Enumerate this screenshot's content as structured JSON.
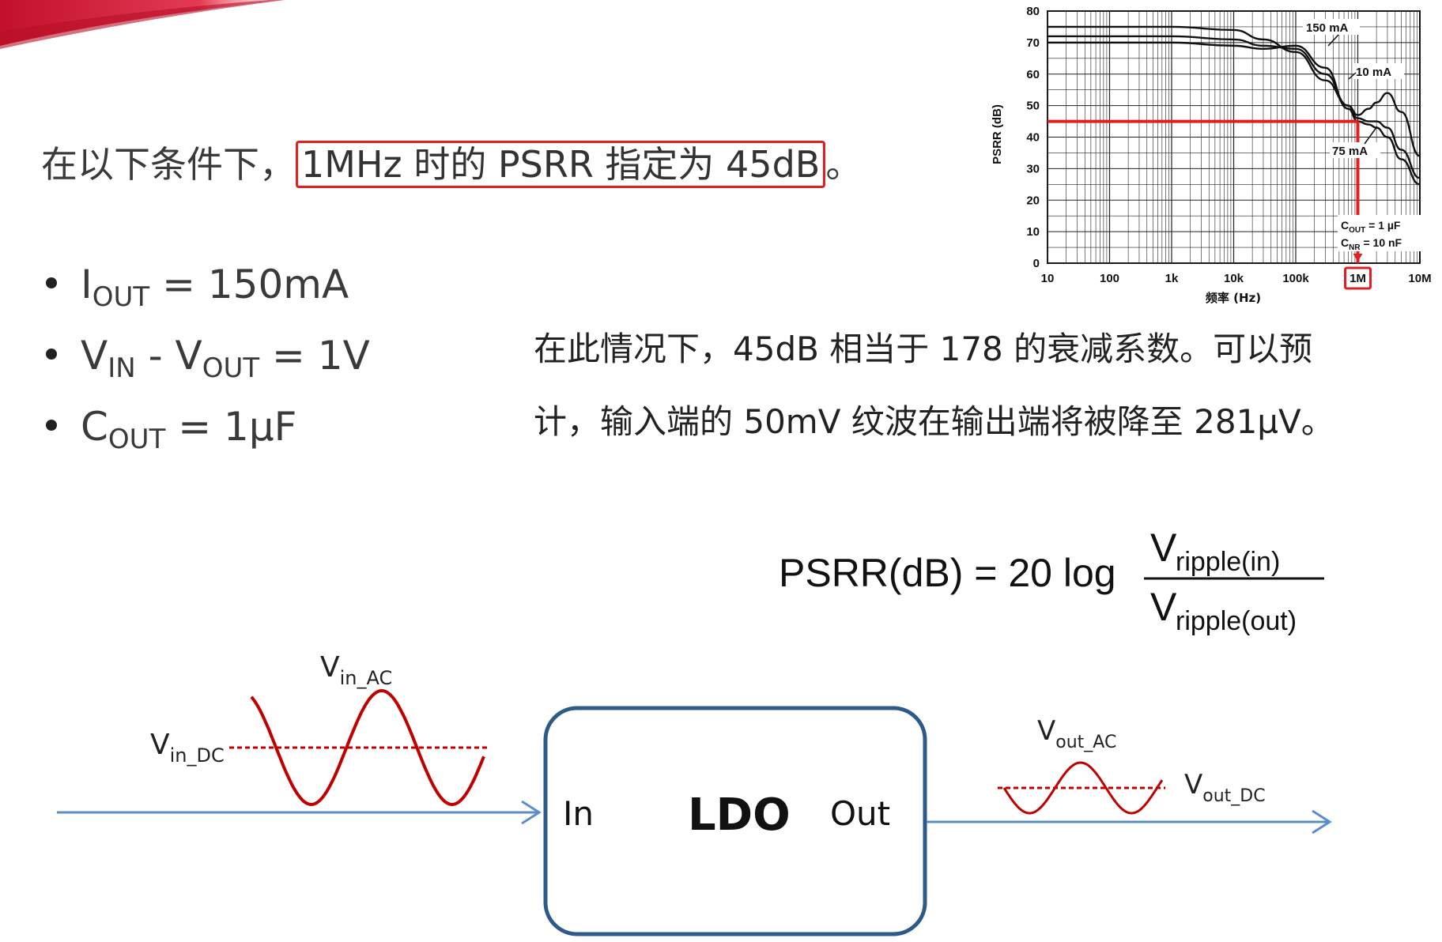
{
  "headline": {
    "prefix": "在以下条件下，",
    "highlight": "1MHz 时的 PSRR 指定为 45dB",
    "suffix": "。"
  },
  "conditions": [
    {
      "main": "I",
      "sub": "OUT",
      "rest": " = 150mA"
    },
    {
      "main": "V",
      "sub": "IN",
      "mid": " - V",
      "sub2": "OUT",
      "rest": " = 1V"
    },
    {
      "main": "C",
      "sub": "OUT",
      "rest": " = 1µF"
    }
  ],
  "explanation": {
    "line1": "在此情况下，45dB 相当于 178 的衰减系数。可以预",
    "line2": "计，输入端的 50mV 纹波在输出端将被降至 281µV。"
  },
  "formula": {
    "lhs": "PSRR(dB) = 20  log",
    "numerator_v": "V",
    "numerator_sub": "ripple(in)",
    "denominator_v": "V",
    "denominator_sub": "ripple(out)"
  },
  "chart_data": {
    "type": "line",
    "xlabel": "频率 (Hz)",
    "ylabel": "PSRR (dB)",
    "x_scale": "log",
    "xlim": [
      10,
      10000000
    ],
    "ylim": [
      0,
      80
    ],
    "grid": true,
    "x_ticks": [
      {
        "v": 10,
        "label": "10"
      },
      {
        "v": 100,
        "label": "100"
      },
      {
        "v": 1000,
        "label": "1k"
      },
      {
        "v": 10000,
        "label": "10k"
      },
      {
        "v": 100000,
        "label": "100k"
      },
      {
        "v": 1000000,
        "label": "1M"
      },
      {
        "v": 10000000,
        "label": "10M"
      }
    ],
    "y_ticks": [
      0,
      10,
      20,
      30,
      40,
      50,
      60,
      70,
      80
    ],
    "series": [
      {
        "name": "10 mA",
        "x": [
          10,
          1000,
          10000,
          30000,
          100000,
          300000,
          700000,
          1000000,
          1500000,
          2000000,
          3000000,
          5000000,
          10000000
        ],
        "y": [
          75,
          75,
          74,
          71,
          67,
          58,
          50,
          47,
          49,
          51,
          54,
          48,
          34
        ]
      },
      {
        "name": "75 mA",
        "x": [
          10,
          1000,
          10000,
          30000,
          100000,
          300000,
          700000,
          1000000,
          1500000,
          2000000,
          3000000,
          5000000,
          10000000
        ],
        "y": [
          72,
          72,
          71,
          69,
          68,
          60,
          50,
          46,
          45,
          45,
          43,
          36,
          27
        ]
      },
      {
        "name": "150 mA",
        "x": [
          10,
          1000,
          10000,
          30000,
          100000,
          300000,
          700000,
          1000000,
          1500000,
          2000000,
          3000000,
          5000000,
          10000000
        ],
        "y": [
          70,
          70,
          69,
          68,
          69,
          62,
          49,
          45,
          44,
          43,
          40,
          33,
          25
        ]
      }
    ],
    "annotations": {
      "label_150": "150 mA",
      "label_10": "10 mA",
      "label_75": "75 mA",
      "cout_main": "C",
      "cout_sub": "OUT",
      "cout_rest": " = 1 µF",
      "cnr_main": "C",
      "cnr_sub": "NR",
      "cnr_rest": " = 10 nF"
    },
    "highlight": {
      "y": 45,
      "x": 1000000,
      "color": "#e02020"
    }
  },
  "diagram": {
    "vin_ac_main": "V",
    "vin_ac_sub": "in_AC",
    "vin_dc_main": "V",
    "vin_dc_sub": "in_DC",
    "vout_ac_main": "V",
    "vout_ac_sub": "out_AC",
    "vout_dc_main": "V",
    "vout_dc_sub": "out_DC",
    "block_in": "In",
    "block_title": "LDO",
    "block_out": "Out"
  },
  "colors": {
    "accent_red": "#e02020",
    "wave_red": "#c00000",
    "line_blue": "#5b8ec9",
    "box_blue": "#2e5a8a"
  }
}
